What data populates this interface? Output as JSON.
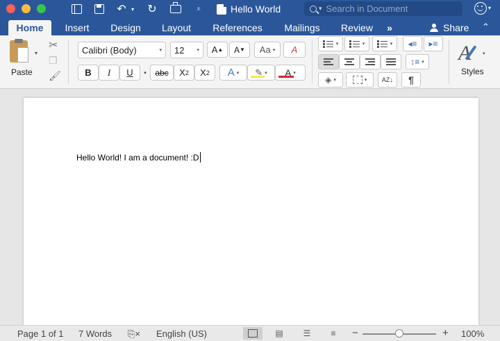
{
  "window": {
    "title": "Hello World"
  },
  "search": {
    "placeholder": "Search in Document"
  },
  "tabs": [
    {
      "label": "Home",
      "active": true
    },
    {
      "label": "Insert"
    },
    {
      "label": "Design"
    },
    {
      "label": "Layout"
    },
    {
      "label": "References"
    },
    {
      "label": "Mailings"
    },
    {
      "label": "Review"
    }
  ],
  "tabs_more": "»",
  "share": {
    "label": "Share",
    "collapse": "⌃"
  },
  "clipboard": {
    "paste_label": "Paste"
  },
  "font": {
    "name": "Calibri (Body)",
    "size": "12",
    "grow": "A",
    "shrink": "A",
    "change_case": "Aa",
    "clear_format": "A",
    "bold": "B",
    "italic": "I",
    "underline": "U",
    "strikethrough": "abc",
    "subscript": "X",
    "subscript_sub": "2",
    "superscript": "X",
    "superscript_sup": "2",
    "text_effects": "A",
    "font_color": "A",
    "highlight_color": "#f7e94b",
    "font_color_value": "#d9232e"
  },
  "paragraph": {
    "pilcrow": "¶",
    "sort": "AZ"
  },
  "styles": {
    "label": "Styles"
  },
  "document": {
    "text": "Hello World! I am a document! :D"
  },
  "status": {
    "page": "Page 1 of 1",
    "words": "7 Words",
    "language": "English (US)",
    "zoom_minus": "−",
    "zoom_plus": "+",
    "zoom": "100%",
    "zoom_level": 0.5
  },
  "colors": {
    "brand": "#2b579a",
    "ribbon": "#f4f4f4"
  }
}
